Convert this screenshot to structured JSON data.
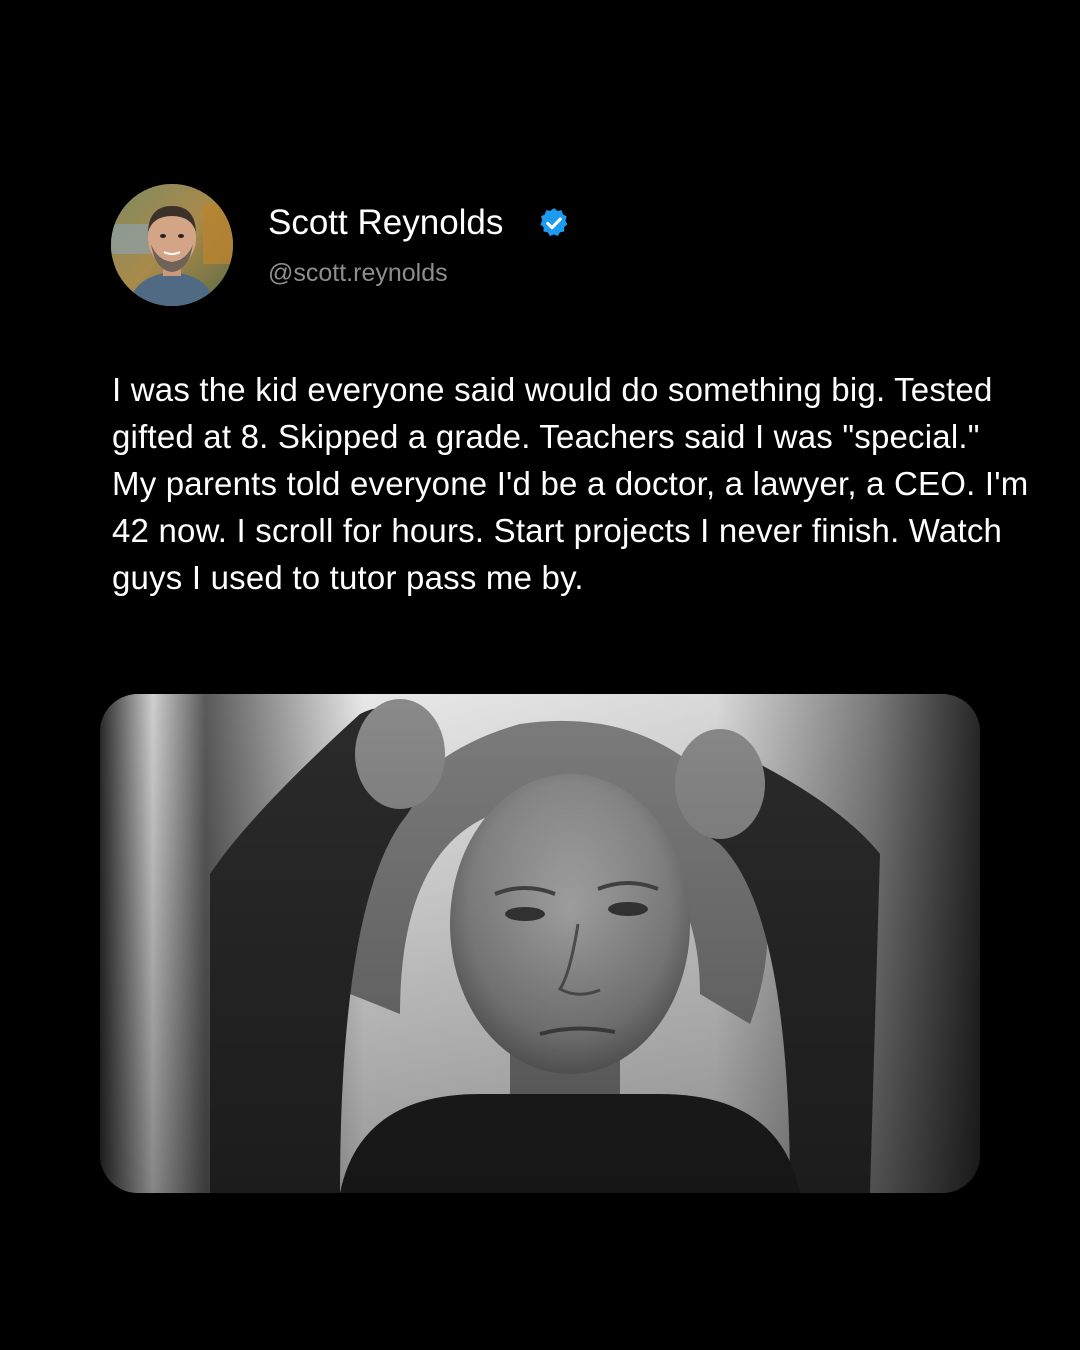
{
  "post": {
    "author": {
      "name": "Scott Reynolds",
      "handle": "@scott.reynolds",
      "verified": true,
      "avatar_icon": "avatar-photo"
    },
    "text": "I was the kid everyone said would do something big. Tested gifted at 8. Skipped a grade. Teachers said I was \"special.\" My parents told everyone I'd be a doctor, a lawyer, a CEO. I'm 42 now. I scroll for hours. Start projects I never finish. Watch guys I used to tutor pass me by.",
    "image": {
      "icon": "photo",
      "style": "black-and-white"
    },
    "colors": {
      "background": "#000000",
      "name": "#ffffff",
      "handle": "#8e8e8e",
      "verified_badge": "#1d9bf0"
    }
  }
}
